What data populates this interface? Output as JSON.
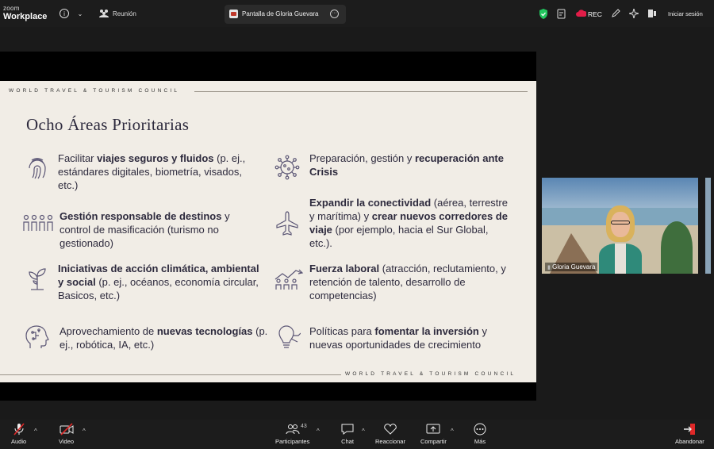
{
  "app": {
    "logo_line1": "zoom",
    "logo_line2": "Workplace"
  },
  "topbar": {
    "meeting_label": "Reunión",
    "share_tab_label": "Pantalla de Gloria Guevara",
    "rec_label": "REC",
    "signin_label": "Iniciar sesión"
  },
  "slide": {
    "header_org": "WORLD TRAVEL & TOURISM COUNCIL",
    "footer_org": "WORLD TRAVEL & TOURISM COUNCIL",
    "title": "Ocho Áreas Prioritarias",
    "items": [
      {
        "pre": "Facilitar ",
        "bold": "viajes seguros y fluidos",
        "post": " (p. ej., estándares digitales, biometría, visados, etc.)",
        "icon": "fingerprint-icon"
      },
      {
        "pre": "Preparación, gestión y ",
        "bold": "recuperación ante Crisis",
        "post": "",
        "icon": "virus-icon"
      },
      {
        "pre": "",
        "bold": "Gestión responsable de destinos",
        "post": " y control de masificación (turismo no gestionado)",
        "icon": "crowd-icon"
      },
      {
        "pre": "",
        "bold": "Expandir la conectividad",
        "post": " (aérea, terrestre y marítima) y ",
        "bold2": "crear nuevos corredores de viaje",
        "post2": " (por ejemplo, hacia el Sur Global, etc.).",
        "icon": "airplane-icon"
      },
      {
        "pre": "",
        "bold": "Iniciativas de acción climática, ambiental y social",
        "post": " (p. ej., océanos, economía circular, Basicos, etc.)",
        "icon": "plant-icon"
      },
      {
        "pre": "",
        "bold": "Fuerza laboral",
        "post": " (atracción, reclutamiento, y retención de talento, desarrollo de competencias)",
        "icon": "workforce-icon"
      },
      {
        "pre": "Aprovechamiento de ",
        "bold": "nuevas tecnologías",
        "post": " (p. ej., robótica, IA, etc.)",
        "icon": "head-brain-icon"
      },
      {
        "pre": "Políticas para ",
        "bold": "fomentar la inversión",
        "post": " y nuevas oportunidades de crecimiento",
        "icon": "lightbulb-icon"
      }
    ]
  },
  "video": {
    "participant_name": "Gloria Guevara"
  },
  "bottombar": {
    "audio": "Audio",
    "video": "Video",
    "participants": "Participantes",
    "participants_count": "43",
    "chat": "Chat",
    "react": "Reaccionar",
    "share": "Compartir",
    "more": "Más",
    "leave": "Abandonar"
  },
  "colors": {
    "leave_red": "#e02828",
    "shield_green": "#22c55e",
    "rec_red": "#e11d48",
    "slide_bg": "#f1ede6",
    "slide_text": "#2d2a3d",
    "icon_stroke": "#5b5675"
  }
}
